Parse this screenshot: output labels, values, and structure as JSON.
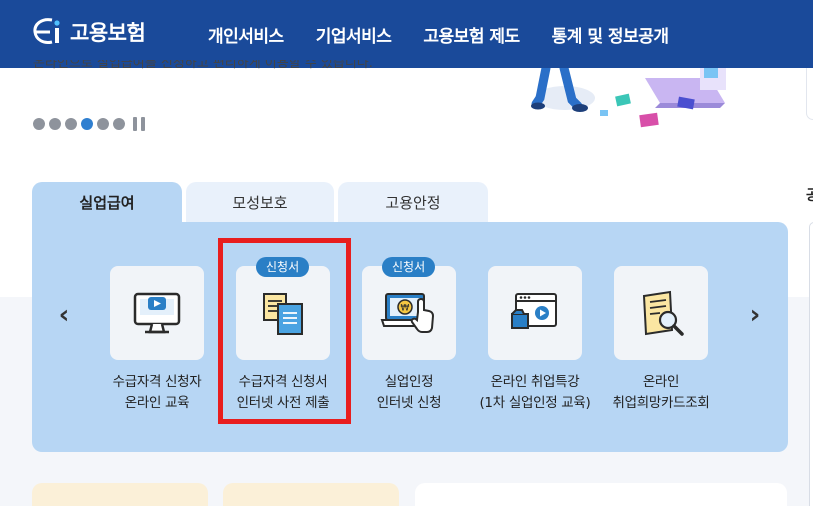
{
  "header": {
    "logo_text": "고용보험",
    "nav": [
      "개인서비스",
      "기업서비스",
      "고용보험 제도",
      "통계 및 정보공개"
    ]
  },
  "hero": {
    "partial_text": "온라인으로 실업급여를 신청하고 편리하게 이용할 수 있습니다.",
    "slide_count": 6,
    "active_slide": 4
  },
  "tabs": [
    {
      "label": "실업급여",
      "active": true
    },
    {
      "label": "모성보호",
      "active": false
    },
    {
      "label": "고용안정",
      "active": false
    }
  ],
  "services": [
    {
      "line1": "수급자격 신청자",
      "line2": "온라인 교육",
      "icon": "monitor-play-icon",
      "badge": ""
    },
    {
      "line1": "수급자격 신청서",
      "line2": "인터넷 사전 제출",
      "icon": "documents-icon",
      "badge": "신청서"
    },
    {
      "line1": "실업인정",
      "line2": "인터넷 신청",
      "icon": "laptop-won-click-icon",
      "badge": "신청서"
    },
    {
      "line1": "온라인 취업특강",
      "line2": "(1차 실업인정 교육)",
      "icon": "browser-video-icon",
      "badge": ""
    },
    {
      "line1": "온라인",
      "line2": "취업희망카드조회",
      "icon": "card-search-icon",
      "badge": ""
    }
  ],
  "sidebar": {
    "partial_heading": "공"
  },
  "colors": {
    "header_bg": "#1a4a9a",
    "panel_bg": "#b7d6f4",
    "badge_bg": "#2a7fc6",
    "highlight": "#e81e1e",
    "active_dot": "#2f7fd0"
  }
}
